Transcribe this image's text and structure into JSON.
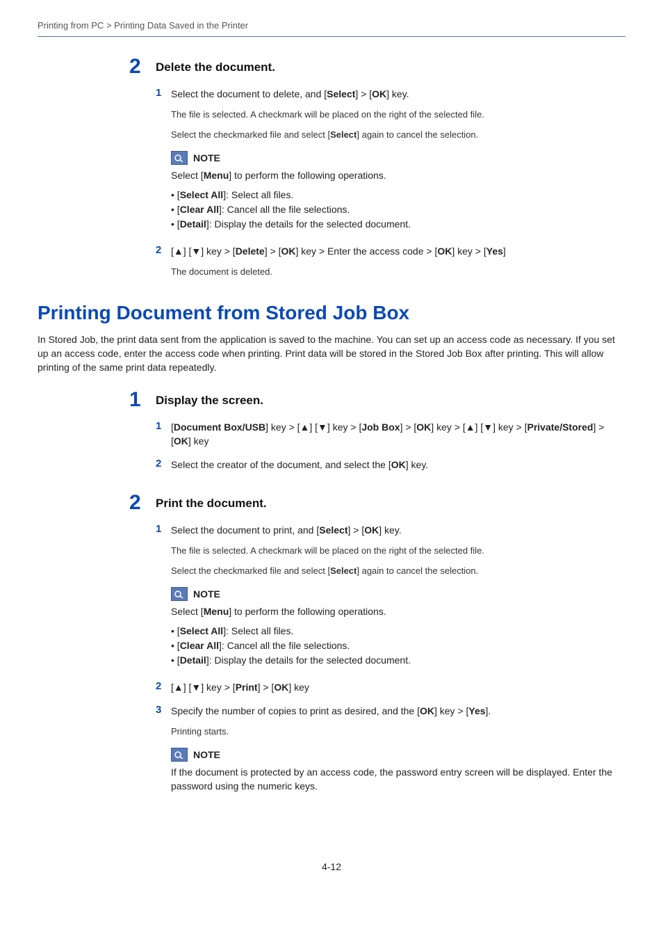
{
  "breadcrumb": "Printing from PC > Printing Data Saved in the Printer",
  "pageNumber": "4-12",
  "sec_delete": {
    "num": "2",
    "title": "Delete the document.",
    "s1": {
      "num": "1",
      "line": "Select the document to delete, and [<b>Select</b>] > [<b>OK</b>] key.",
      "p1": "The file is selected. A checkmark will be placed on the right of the selected file.",
      "p2": "Select the checkmarked file and select [<b>Select</b>] again to cancel the selection."
    },
    "note": {
      "title": "NOTE",
      "lead": "Select [<b>Menu</b>] to perform the following operations.",
      "b1": "• [<b>Select All</b>]: Select all files.",
      "b2": "• [<b>Clear All</b>]: Cancel all the file selections.",
      "b3": "• [<b>Detail</b>]: Display the details for the selected document."
    },
    "s2": {
      "num": "2",
      "line": "[▲] [▼] key > [<b>Delete</b>] > [<b>OK</b>] key > Enter the access code > [<b>OK</b>] key > [<b>Yes</b>]",
      "p1": "The document is deleted."
    }
  },
  "h1": "Printing Document from Stored Job Box",
  "intro": "In Stored Job, the print data sent from the application is saved to the machine. You can set up an access code as necessary. If you set up an access code, enter the access code when printing. Print data will be stored in the Stored Job Box after printing. This will allow printing of the same print data repeatedly.",
  "sec_display": {
    "num": "1",
    "title": "Display the screen.",
    "s1": {
      "num": "1",
      "line": "[<b>Document Box/USB</b>] key > [▲] [▼] key > [<b>Job Box</b>] > [<b>OK</b>] key > [▲] [▼] key > [<b>Private/Stored</b>] > [<b>OK</b>] key"
    },
    "s2": {
      "num": "2",
      "line": "Select the creator of the document, and select the [<b>OK</b>] key."
    }
  },
  "sec_print": {
    "num": "2",
    "title": "Print the document.",
    "s1": {
      "num": "1",
      "line": "Select the document to print, and [<b>Select</b>] > [<b>OK</b>] key.",
      "p1": "The file is selected. A checkmark will be placed on the right of the selected file.",
      "p2": "Select the checkmarked file and select [<b>Select</b>] again to cancel the selection."
    },
    "note1": {
      "title": "NOTE",
      "lead": "Select [<b>Menu</b>] to perform the following operations.",
      "b1": "• [<b>Select All</b>]: Select all files.",
      "b2": "• [<b>Clear All</b>]: Cancel all the file selections.",
      "b3": "• [<b>Detail</b>]: Display the details for the selected document."
    },
    "s2": {
      "num": "2",
      "line": "[▲] [▼] key > [<b>Print</b>] > [<b>OK</b>] key"
    },
    "s3": {
      "num": "3",
      "line": "Specify the number of copies to print as desired, and the [<b>OK</b>] key > [<b>Yes</b>].",
      "p1": "Printing starts."
    },
    "note2": {
      "title": "NOTE",
      "body": "If the document is protected by an access code, the password entry screen will be displayed. Enter the password using the numeric keys."
    }
  }
}
